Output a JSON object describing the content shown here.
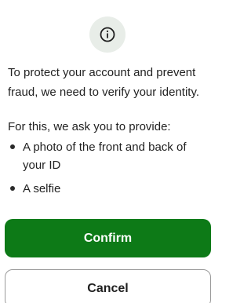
{
  "colors": {
    "accent": "#0d7a17",
    "icon_background": "#e8ede8"
  },
  "dialog": {
    "icon": "info-icon",
    "intro_text": "To protect your account and prevent fraud, we need to verify your identity.",
    "ask_text": "For this, we ask you to provide:",
    "requirements": [
      "A photo of the front and back of your ID",
      "A selfie"
    ],
    "confirm_label": "Confirm",
    "cancel_label": "Cancel"
  }
}
